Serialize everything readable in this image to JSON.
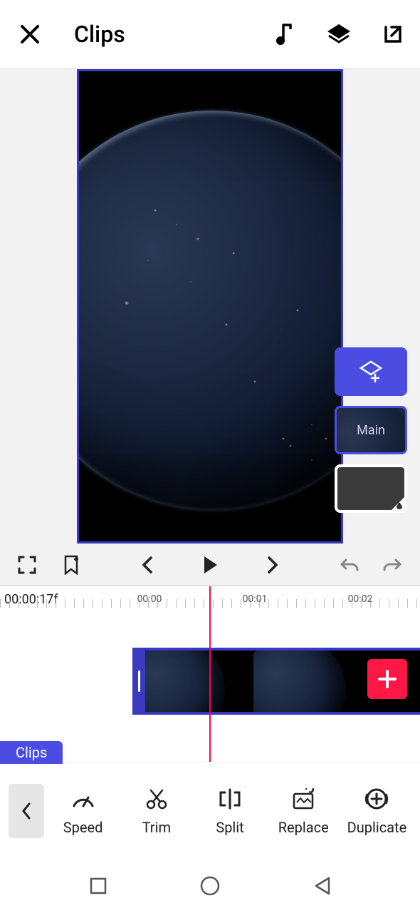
{
  "header": {
    "title": "Clips"
  },
  "panel": {
    "main_label": "Main"
  },
  "timeline": {
    "current": "00:00:17f",
    "marks": [
      "00:00",
      "00:01",
      "00:02"
    ]
  },
  "clips_tab": "Clips",
  "tools": [
    {
      "label": "Speed"
    },
    {
      "label": "Trim"
    },
    {
      "label": "Split"
    },
    {
      "label": "Replace"
    },
    {
      "label": "Duplicate"
    }
  ]
}
